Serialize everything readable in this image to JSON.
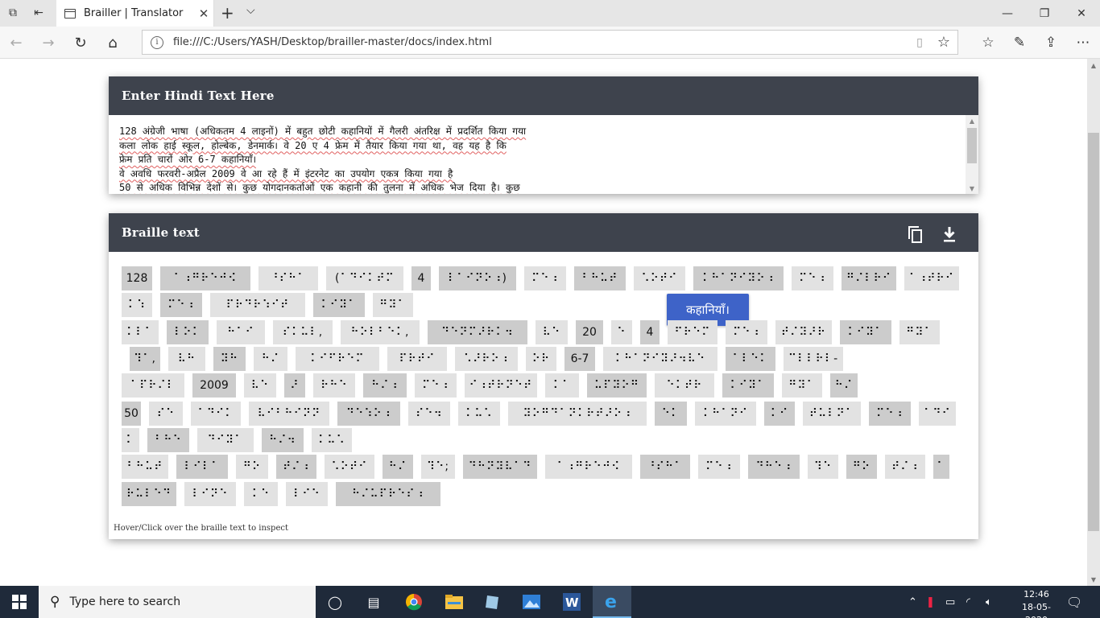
{
  "browser": {
    "tab_title": "Brailler | Translator",
    "url": "file:///C:/Users/YASH/Desktop/brailler-master/docs/index.html"
  },
  "input_card": {
    "title": "Enter Hindi Text Here",
    "lines": [
      "128 अंग्रेजी भाषा (अधिकतम 4 लाइनों) में बहुत छोटी कहानियों में गैलरी अंतरिक्ष में प्रदर्शित किया गया",
      "कला लोक हाई स्कूल, होल्बेक, डेनमार्क। वे 20 ए 4 फ्रेम में तैयार किया गया था, वह यह है कि",
      "फ्रेम प्रति चारों ओर 6-7 कहानियाँ।",
      "वे अवधि फरवरी-अप्रैल 2009 वे आ रहे हैं में इंटरनेट का उपयोग एकत्र किया गया है",
      "50 से अधिक विभिन्न देशों से। कुछ योगदानकर्ताओं एक कहानी की तुलना में अधिक भेज दिया है। कुछ"
    ]
  },
  "braille_card": {
    "title": "Braille text",
    "copy_icon": "copy-icon",
    "download_icon": "download-icon",
    "tooltip": "कहानियाँ।",
    "hint": "Hover/Click over the braille text to inspect",
    "rows": [
      [
        {
          "t": "128",
          "s": "d",
          "w": 38
        },
        {
          "t": "⠁⠰⠛⠗⠑⠚⠪",
          "s": "d",
          "w": 112
        },
        {
          "t": "⠘⠎⠓⠁",
          "s": "l",
          "w": 74
        },
        {
          "t": "(⠁⠙⠊⠅⠞⠍",
          "s": "l",
          "w": 96
        },
        {
          "t": "4",
          "s": "d",
          "w": 24
        },
        {
          "t": "⠇⠁⠊⠝⠕⠰)",
          "s": "d",
          "w": 96
        },
        {
          "t": "⠍⠑⠰",
          "s": "l",
          "w": 52
        },
        {
          "t": "⠃⠓⠥⠞",
          "s": "d",
          "w": 64
        },
        {
          "t": "⠡⠕⠞⠊",
          "s": "l",
          "w": 64
        },
        {
          "t": "⠅⠓⠁⠝⠊⠽⠕⠰",
          "s": "d",
          "w": 112
        },
        {
          "t": "⠍⠑⠰",
          "s": "l",
          "w": 52
        },
        {
          "t": "⠛⠌⠇⠗⠊",
          "s": "d",
          "w": 68
        },
        {
          "t": "⠁⠰⠞⠗⠊",
          "s": "l",
          "w": 68
        }
      ],
      [
        {
          "t": "⠅⠱",
          "s": "l",
          "w": 38
        },
        {
          "t": "⠍⠑⠰",
          "s": "d",
          "w": 52
        },
        {
          "t": "⠏⠗⠙⠗⠱⠊⠞",
          "s": "l",
          "w": 118
        },
        {
          "t": "⠅⠊⠽⠁",
          "s": "d",
          "w": 64
        },
        {
          "t": "⠛⠽⠁",
          "s": "l",
          "w": 50
        }
      ],
      [
        {
          "t": "⠅⠇⠁",
          "s": "l",
          "w": 46
        },
        {
          "t": "⠇⠕⠅",
          "s": "d",
          "w": 52
        },
        {
          "t": "⠓⠁⠊",
          "s": "l",
          "w": 60
        },
        {
          "t": "⠎⠅⠥⠇,",
          "s": "l",
          "w": 74
        },
        {
          "t": "⠓⠕⠇⠃⠑⠅,",
          "s": "l",
          "w": 98
        },
        {
          "t": "⠙⠑⠝⠍⠜⠗⠅⠲",
          "s": "d",
          "w": 124
        },
        {
          "t": "⠧⠑",
          "s": "l",
          "w": 40
        },
        {
          "t": "20",
          "s": "d",
          "w": 34
        },
        {
          "t": "⠑",
          "s": "l",
          "w": 26
        },
        {
          "t": "4",
          "s": "d",
          "w": 24
        },
        {
          "t": "⠋⠗⠑⠍",
          "s": "l",
          "w": 62
        },
        {
          "t": "⠍⠑⠰",
          "s": "l",
          "w": 52
        },
        {
          "t": "⠞⠌⠽⠜⠗",
          "s": "l",
          "w": 70
        },
        {
          "t": "⠅⠊⠽⠁",
          "s": "d",
          "w": 64
        },
        {
          "t": "⠛⠽⠁",
          "s": "l",
          "w": 50
        }
      ],
      [
        {
          "t": "⠹⠁,",
          "s": "d",
          "w": 38
        },
        {
          "t": "⠧⠓",
          "s": "l",
          "w": 46
        },
        {
          "t": "⠽⠓",
          "s": "d",
          "w": 40
        },
        {
          "t": "⠓⠌",
          "s": "l",
          "w": 42
        },
        {
          "t": "⠅⠊⠋⠗⠑⠍",
          "s": "l",
          "w": 104
        },
        {
          "t": "⠏⠗⠞⠊",
          "s": "l",
          "w": 74
        },
        {
          "t": "⠡⠜⠗⠕⠰",
          "s": "l",
          "w": 78
        },
        {
          "t": "⠕⠗",
          "s": "l",
          "w": 38
        },
        {
          "t": "6-7",
          "s": "d",
          "w": 38
        },
        {
          "t": "⠅⠓⠁⠝⠊⠽⠜⠲⠧⠑",
          "s": "l",
          "w": 142
        },
        {
          "t": "⠁⠇⠑⠅",
          "s": "d",
          "w": 62
        },
        {
          "t": "⠉⠇⠇⠗⠇-",
          "s": "l",
          "w": 74
        }
      ],
      [
        {
          "t": "⠁⠏⠗⠌⠇",
          "s": "l",
          "w": 78
        },
        {
          "t": "2009",
          "s": "d",
          "w": 54
        },
        {
          "t": "⠧⠑",
          "s": "l",
          "w": 40
        },
        {
          "t": "⠜",
          "s": "d",
          "w": 26
        },
        {
          "t": "⠗⠓⠑",
          "s": "l",
          "w": 52
        },
        {
          "t": "⠓⠌⠰",
          "s": "d",
          "w": 54
        },
        {
          "t": "⠍⠑⠰",
          "s": "l",
          "w": 52
        },
        {
          "t": "⠊⠰⠞⠗⠝⠑⠞",
          "s": "l",
          "w": 90
        },
        {
          "t": "⠅⠁",
          "s": "l",
          "w": 42
        },
        {
          "t": "⠥⠏⠽⠕⠛",
          "s": "d",
          "w": 74
        },
        {
          "t": "⠑⠅⠞⠗",
          "s": "l",
          "w": 74
        },
        {
          "t": "⠅⠊⠽⠁",
          "s": "d",
          "w": 64
        },
        {
          "t": "⠛⠽⠁",
          "s": "l",
          "w": 50
        },
        {
          "t": "⠓⠌",
          "s": "d",
          "w": 34
        }
      ],
      [
        {
          "t": "50",
          "s": "d",
          "w": 24
        },
        {
          "t": "⠎⠑",
          "s": "l",
          "w": 42
        },
        {
          "t": "⠁⠙⠊⠅",
          "s": "l",
          "w": 62
        },
        {
          "t": "⠧⠊⠃⠓⠊⠝⠝",
          "s": "l",
          "w": 100
        },
        {
          "t": "⠙⠑⠱⠕⠰",
          "s": "d",
          "w": 78
        },
        {
          "t": "⠎⠑⠲",
          "s": "l",
          "w": 52
        },
        {
          "t": "⠅⠥⠡",
          "s": "l",
          "w": 52
        },
        {
          "t": "⠽⠕⠛⠙⠁⠝⠅⠗⠞⠜⠕⠰",
          "s": "l",
          "w": 172
        },
        {
          "t": "⠑⠅",
          "s": "d",
          "w": 40
        },
        {
          "t": "⠅⠓⠁⠝⠊",
          "s": "l",
          "w": 76
        },
        {
          "t": "⠅⠊",
          "s": "d",
          "w": 38
        },
        {
          "t": "⠞⠥⠇⠝⠁",
          "s": "l",
          "w": 72
        },
        {
          "t": "⠍⠑⠰",
          "s": "d",
          "w": 52
        },
        {
          "t": "⠁⠙⠊",
          "s": "l",
          "w": 46
        }
      ],
      [
        {
          "t": "⠅",
          "s": "l",
          "w": 22
        },
        {
          "t": "⠃⠓⠑",
          "s": "d",
          "w": 52
        },
        {
          "t": "⠙⠊⠽⠁",
          "s": "l",
          "w": 70
        },
        {
          "t": "⠓⠌⠲",
          "s": "d",
          "w": 52
        },
        {
          "t": "⠅⠥⠡",
          "s": "l",
          "w": 50
        }
      ],
      [
        {
          "t": "⠃⠓⠥⠞",
          "s": "l",
          "w": 58
        },
        {
          "t": "⠇⠊⠇⠁",
          "s": "d",
          "w": 64
        },
        {
          "t": "⠛⠕",
          "s": "l",
          "w": 40
        },
        {
          "t": "⠞⠌⠰",
          "s": "d",
          "w": 50
        },
        {
          "t": "⠡⠕⠞⠊",
          "s": "l",
          "w": 62
        },
        {
          "t": "⠓⠌",
          "s": "d",
          "w": 38
        },
        {
          "t": "⠹⠑;",
          "s": "l",
          "w": 42
        },
        {
          "t": "⠙⠓⠝⠽⠧⠁⠙",
          "s": "d",
          "w": 92
        },
        {
          "t": "⠁⠰⠛⠗⠑⠚⠪",
          "s": "l",
          "w": 108
        },
        {
          "t": "⠘⠎⠓⠁",
          "s": "d",
          "w": 62
        },
        {
          "t": "⠍⠑⠰",
          "s": "l",
          "w": 52
        },
        {
          "t": "⠙⠓⠑⠰",
          "s": "d",
          "w": 64
        },
        {
          "t": "⠹⠑",
          "s": "l",
          "w": 38
        },
        {
          "t": "⠛⠕",
          "s": "d",
          "w": 38
        },
        {
          "t": "⠞⠌⠰",
          "s": "l",
          "w": 50
        },
        {
          "t": "⠁",
          "s": "d",
          "w": 20
        }
      ],
      [
        {
          "t": "⠗⠥⠇⠑⠙",
          "s": "d",
          "w": 68
        },
        {
          "t": "⠇⠊⠝⠑",
          "s": "l",
          "w": 64
        },
        {
          "t": "⠅⠑",
          "s": "l",
          "w": 42
        },
        {
          "t": "⠇⠊⠑",
          "s": "l",
          "w": 52
        },
        {
          "t": "⠓⠌⠥⠏⠗⠑⠎⠰",
          "s": "d",
          "w": 130
        }
      ]
    ]
  },
  "taskbar": {
    "search_placeholder": "Type here to search",
    "time": "12:46",
    "date": "18-05-2020"
  }
}
